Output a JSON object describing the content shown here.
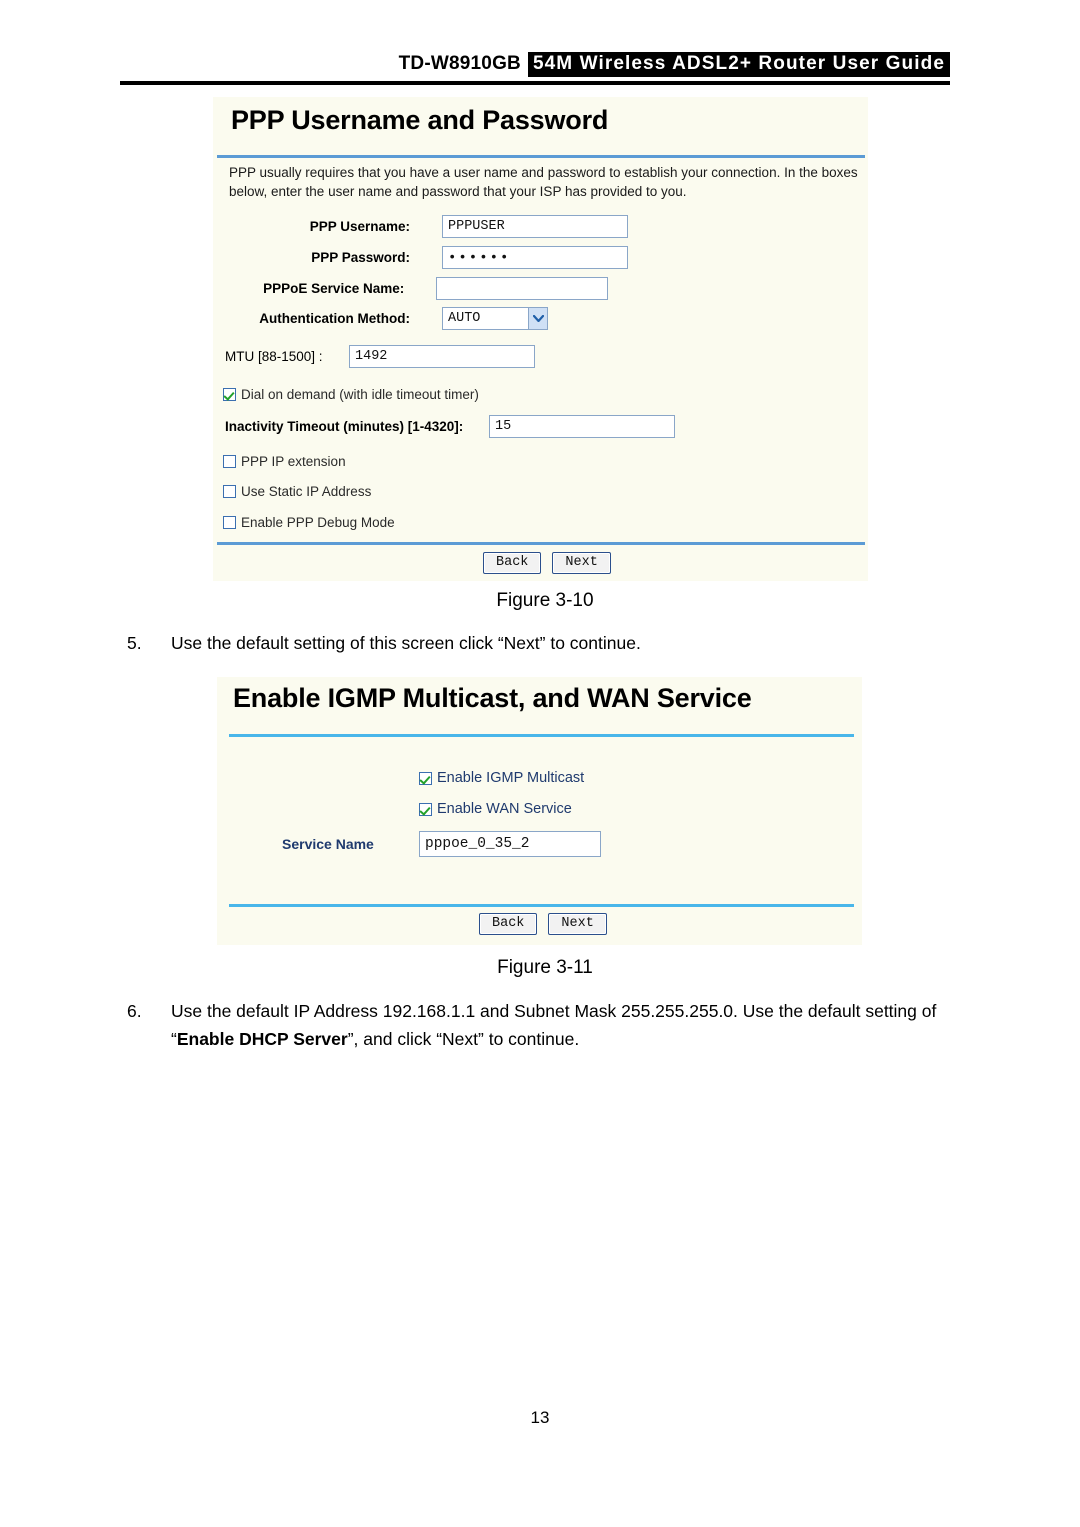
{
  "header": {
    "model": "TD-W8910GB",
    "title": "54M  Wireless  ADSL2+  Router  User  Guide"
  },
  "figure_310": {
    "panel_title": "PPP Username and Password",
    "intro": "PPP usually requires that you have a user name and password to establish your connection. In the boxes below, enter the user name and password that your ISP has provided to you.",
    "fields": {
      "username_label": "PPP Username:",
      "username_value": "PPPUSER",
      "password_label": "PPP Password:",
      "password_value": "••••••",
      "service_name_label": "PPPoE Service Name:",
      "service_name_value": "",
      "auth_label": "Authentication Method:",
      "auth_value": "AUTO",
      "mtu_label": "MTU [88-1500] :",
      "mtu_value": "1492",
      "inactivity_label": "Inactivity Timeout (minutes) [1-4320]:",
      "inactivity_value": "15"
    },
    "checkboxes": {
      "dial_on_demand": "Dial on demand (with idle timeout timer)",
      "ppp_ip_extension": "PPP IP extension",
      "use_static_ip": "Use Static IP Address",
      "ppp_debug": "Enable PPP Debug Mode"
    },
    "buttons": {
      "back": "Back",
      "next": "Next"
    },
    "caption": "Figure 3-10"
  },
  "step_5": {
    "number": "5.",
    "text": "Use the default setting of this screen click “Next” to continue."
  },
  "figure_311": {
    "panel_title": "Enable IGMP Multicast, and WAN Service",
    "checkboxes": {
      "igmp_multicast": "Enable IGMP Multicast",
      "wan_service": "Enable WAN Service"
    },
    "fields": {
      "service_name_label": "Service Name",
      "service_name_value": "pppoe_0_35_2"
    },
    "buttons": {
      "back": "Back",
      "next": "Next"
    },
    "caption": "Figure 3-11"
  },
  "step_6": {
    "number": "6.",
    "text_part1": "Use the default IP Address 192.168.1.1 and Subnet Mask 255.255.255.0. Use the default setting of “",
    "bold_part": "Enable DHCP Server",
    "text_part2": "”, and click “Next” to continue."
  },
  "footer": {
    "page_number": "13"
  },
  "colors": {
    "panel_bg": "#fbfbef",
    "blue_rule": "#5b9bd5",
    "cyan_rule": "#49b6ea",
    "input_border": "#8aa6c8",
    "label_blue": "#1f3a6e",
    "check_green": "#23a12a"
  }
}
